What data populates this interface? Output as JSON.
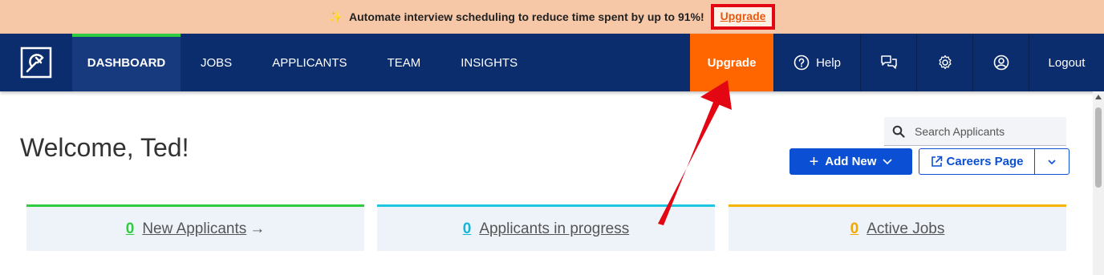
{
  "banner": {
    "text": "Automate interview scheduling to reduce time spent by up to 91%!",
    "upgrade_link": "Upgrade",
    "icon": "party-popper-icon"
  },
  "nav": {
    "items": [
      {
        "label": "DASHBOARD"
      },
      {
        "label": "JOBS"
      },
      {
        "label": "APPLICANTS"
      },
      {
        "label": "TEAM"
      },
      {
        "label": "INSIGHTS"
      }
    ],
    "upgrade": "Upgrade",
    "help": "Help",
    "logout": "Logout"
  },
  "main": {
    "welcome": "Welcome, Ted!",
    "search_placeholder": "Search Applicants",
    "add_new": "Add New",
    "careers_page": "Careers Page"
  },
  "cards": [
    {
      "count": "0",
      "label": "New Applicants"
    },
    {
      "count": "0",
      "label": "Applicants in progress"
    },
    {
      "count": "0",
      "label": "Active Jobs"
    }
  ],
  "colors": {
    "nav_bg": "#0b2d6e",
    "upgrade_orange": "#ff6600",
    "primary_blue": "#0b4fd4",
    "annotation_red": "#e30613"
  }
}
